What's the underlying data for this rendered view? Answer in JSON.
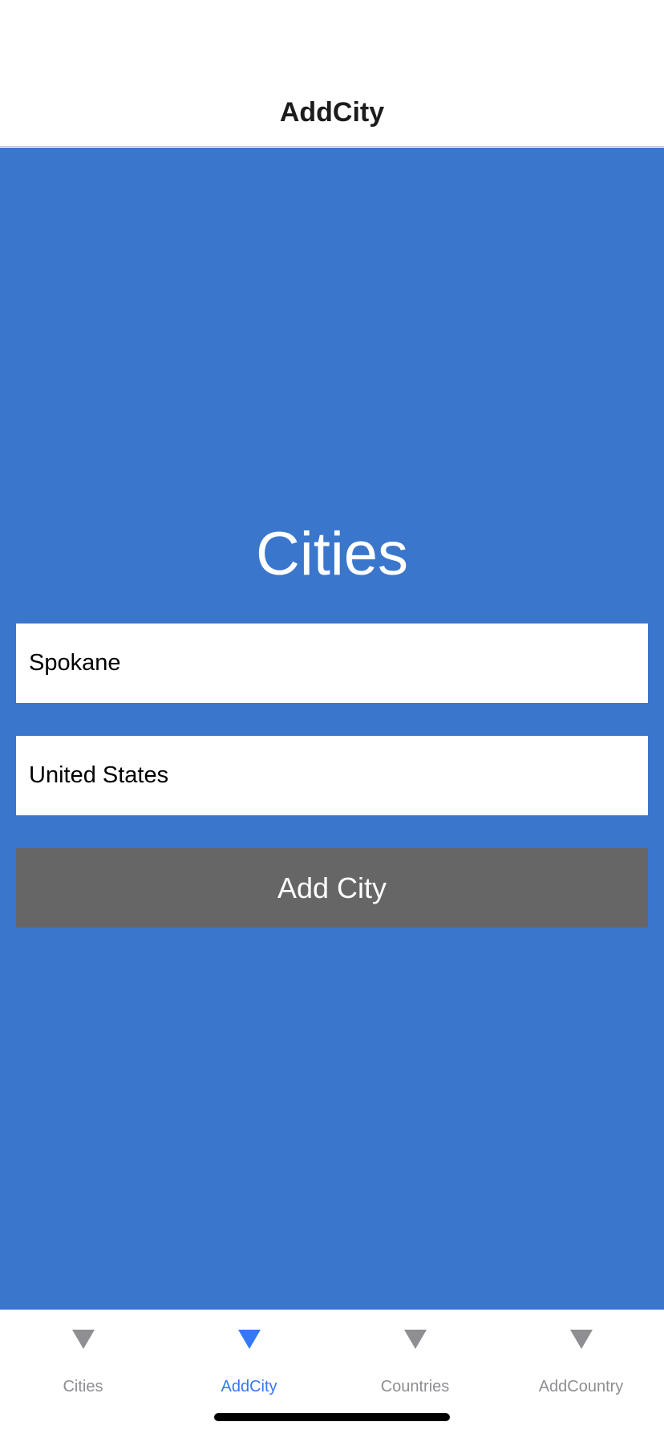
{
  "nav": {
    "title": "AddCity"
  },
  "form": {
    "heading": "Cities",
    "city_value": "Spokane",
    "country_value": "United States",
    "add_label": "Add City"
  },
  "tabs": [
    {
      "label": "Cities",
      "icon": "triangle-down-icon",
      "active": false
    },
    {
      "label": "AddCity",
      "icon": "triangle-down-icon",
      "active": true
    },
    {
      "label": "Countries",
      "icon": "triangle-down-icon",
      "active": false
    },
    {
      "label": "AddCountry",
      "icon": "triangle-down-icon",
      "active": false
    }
  ],
  "colors": {
    "background": "#3b76cd",
    "button": "#666666",
    "tab_active": "#3478f6",
    "tab_inactive": "#8e8e93"
  }
}
